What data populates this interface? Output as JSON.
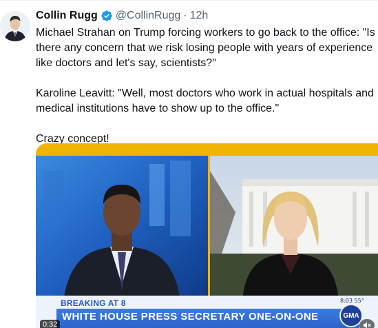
{
  "author": {
    "display_name": "Collin Rugg",
    "handle": "@CollinRugg",
    "time": "12h",
    "verified": true
  },
  "tweet": {
    "paragraphs": [
      "Michael Strahan on Trump forcing workers to go back to the office: \"Is there any concern that we risk losing people with years of experience like doctors and let's say, scientists?\"",
      "Karoline Leavitt: \"Well, most doctors who work in actual hospitals and medical institutions have to show up to the office.\"",
      "Crazy concept!"
    ]
  },
  "video": {
    "breaking_label": "BREAKING",
    "breaking_at": "AT 8",
    "chyron": "WHITE HOUSE PRESS SECRETARY ONE-ON-ONE",
    "clock": "8:03  55°",
    "network_logo": "GMA",
    "duration": "0:32"
  },
  "colors": {
    "frame_yellow": "#f0b400",
    "chyron_blue": "#2f63c9",
    "handle_gray": "#536471",
    "verified_blue": "#1d9bf0"
  },
  "icons": [
    "verified-badge-icon",
    "mute-icon"
  ]
}
